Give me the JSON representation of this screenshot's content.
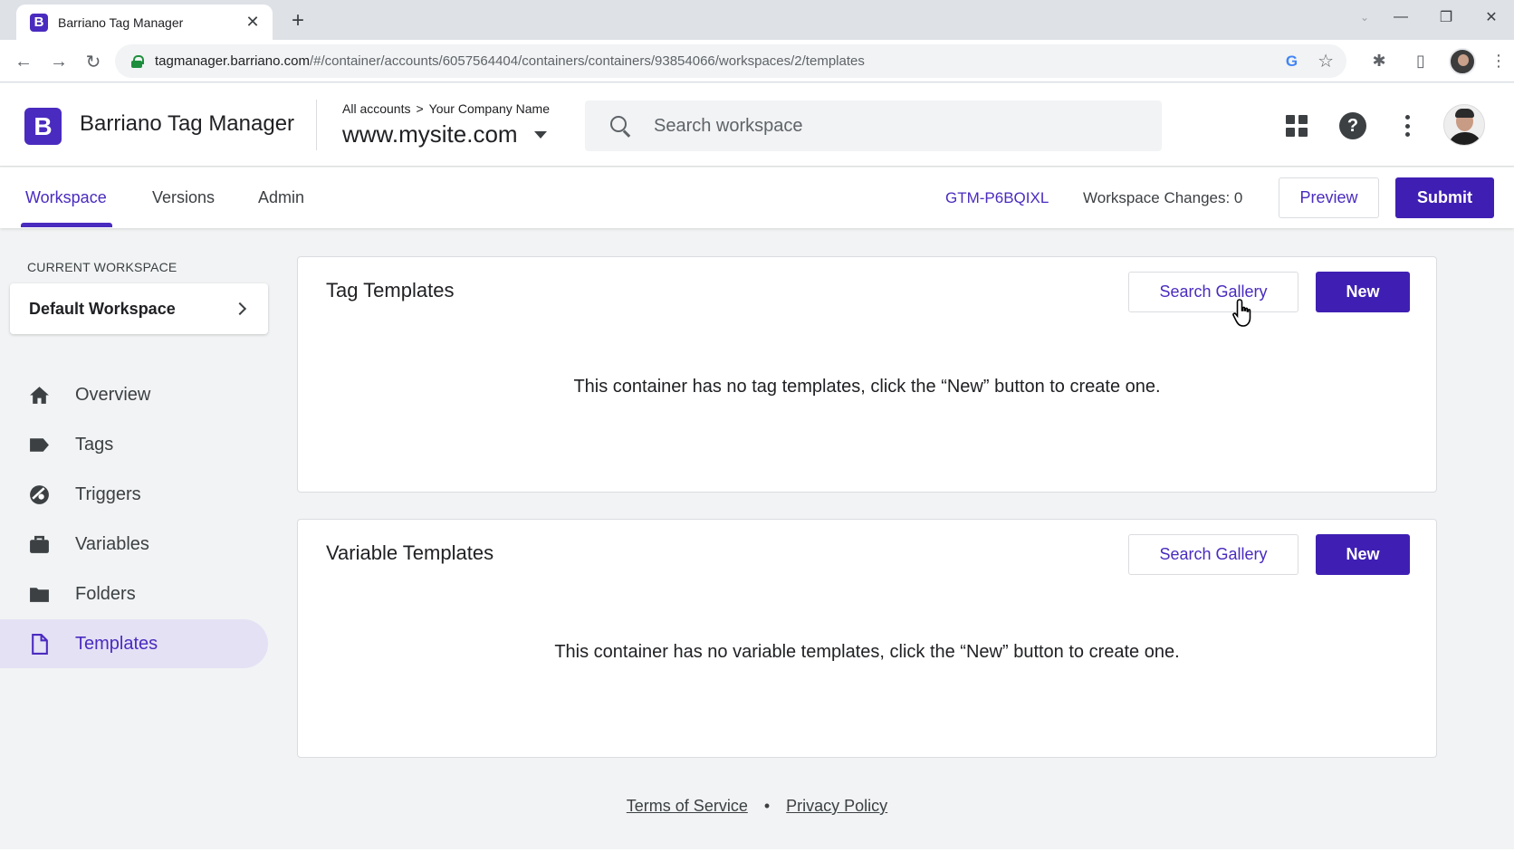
{
  "browser": {
    "tab_title": "Barriano Tag Manager",
    "tab_favicon_letter": "B",
    "url_host": "tagmanager.barriano.com",
    "url_path": "/#/container/accounts/6057564404/containers/containers/93854066/workspaces/2/templates"
  },
  "header": {
    "logo_letter": "B",
    "app_name": "Barriano Tag Manager",
    "breadcrumb_root": "All accounts",
    "breadcrumb_separator": ">",
    "breadcrumb_account": "Your Company Name",
    "container_name": "www.mysite.com",
    "search_placeholder": "Search workspace"
  },
  "nav": {
    "tabs": [
      {
        "label": "Workspace",
        "active": true
      },
      {
        "label": "Versions",
        "active": false
      },
      {
        "label": "Admin",
        "active": false
      }
    ],
    "container_id": "GTM-P6BQIXL",
    "workspace_changes": "Workspace Changes: 0",
    "preview_label": "Preview",
    "submit_label": "Submit"
  },
  "sidebar": {
    "current_workspace_label": "CURRENT WORKSPACE",
    "workspace_name": "Default Workspace",
    "items": [
      {
        "label": "Overview",
        "icon": "home-icon",
        "active": false
      },
      {
        "label": "Tags",
        "icon": "tag-icon",
        "active": false
      },
      {
        "label": "Triggers",
        "icon": "trigger-icon",
        "active": false
      },
      {
        "label": "Variables",
        "icon": "briefcase-icon",
        "active": false
      },
      {
        "label": "Folders",
        "icon": "folder-icon",
        "active": false
      },
      {
        "label": "Templates",
        "icon": "document-icon",
        "active": true
      }
    ]
  },
  "main": {
    "tag_templates": {
      "title": "Tag Templates",
      "search_gallery_label": "Search Gallery",
      "new_label": "New",
      "empty_text": "This container has no tag templates, click the “New” button to create one."
    },
    "variable_templates": {
      "title": "Variable Templates",
      "search_gallery_label": "Search Gallery",
      "new_label": "New",
      "empty_text": "This container has no variable templates, click the “New” button to create one."
    }
  },
  "footer": {
    "terms_label": "Terms of Service",
    "separator": "•",
    "privacy_label": "Privacy Policy"
  },
  "colors": {
    "accent": "#4a2bbf",
    "primary_button": "#3f1fb3",
    "active_nav_bg": "#e4e1f5",
    "page_bg": "#f1f3f4"
  }
}
